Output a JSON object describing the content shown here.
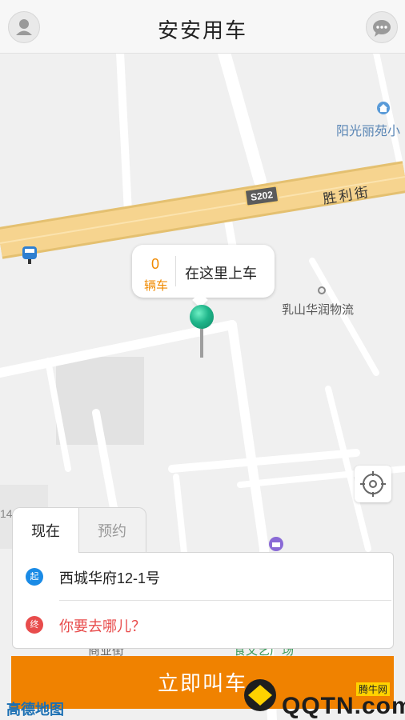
{
  "header": {
    "title": "安安用车",
    "left_icon": "user-icon",
    "right_icon": "message-icon"
  },
  "map": {
    "labels": {
      "poi_community": "阳光丽苑小",
      "road_name": "胜利街",
      "highway_shield": "S202",
      "poi_logistics": "乳山华润物流",
      "edge_number": "14",
      "bottom_road": "商业街",
      "bottom_plaza": "食文艺广场"
    },
    "pickup_bubble": {
      "car_count": "0",
      "car_unit": "辆车",
      "message": "在这里上车"
    },
    "colors": {
      "road_major": "#f6d48f",
      "pin": "#1fb58a"
    }
  },
  "booking": {
    "tabs": [
      {
        "label": "现在",
        "active": true
      },
      {
        "label": "预约",
        "active": false
      }
    ],
    "start": {
      "badge": "起",
      "value": "西城华府12-1号",
      "color": "#1a8be6"
    },
    "end": {
      "badge": "终",
      "placeholder": "你要去哪儿？",
      "color": "#e84c4c"
    }
  },
  "action": {
    "call_label": "立即叫车",
    "color": "#f08200"
  },
  "footer": {
    "map_logo": "高德地图",
    "watermark": "QQTN.com",
    "watermark_tag": "腾牛网"
  }
}
